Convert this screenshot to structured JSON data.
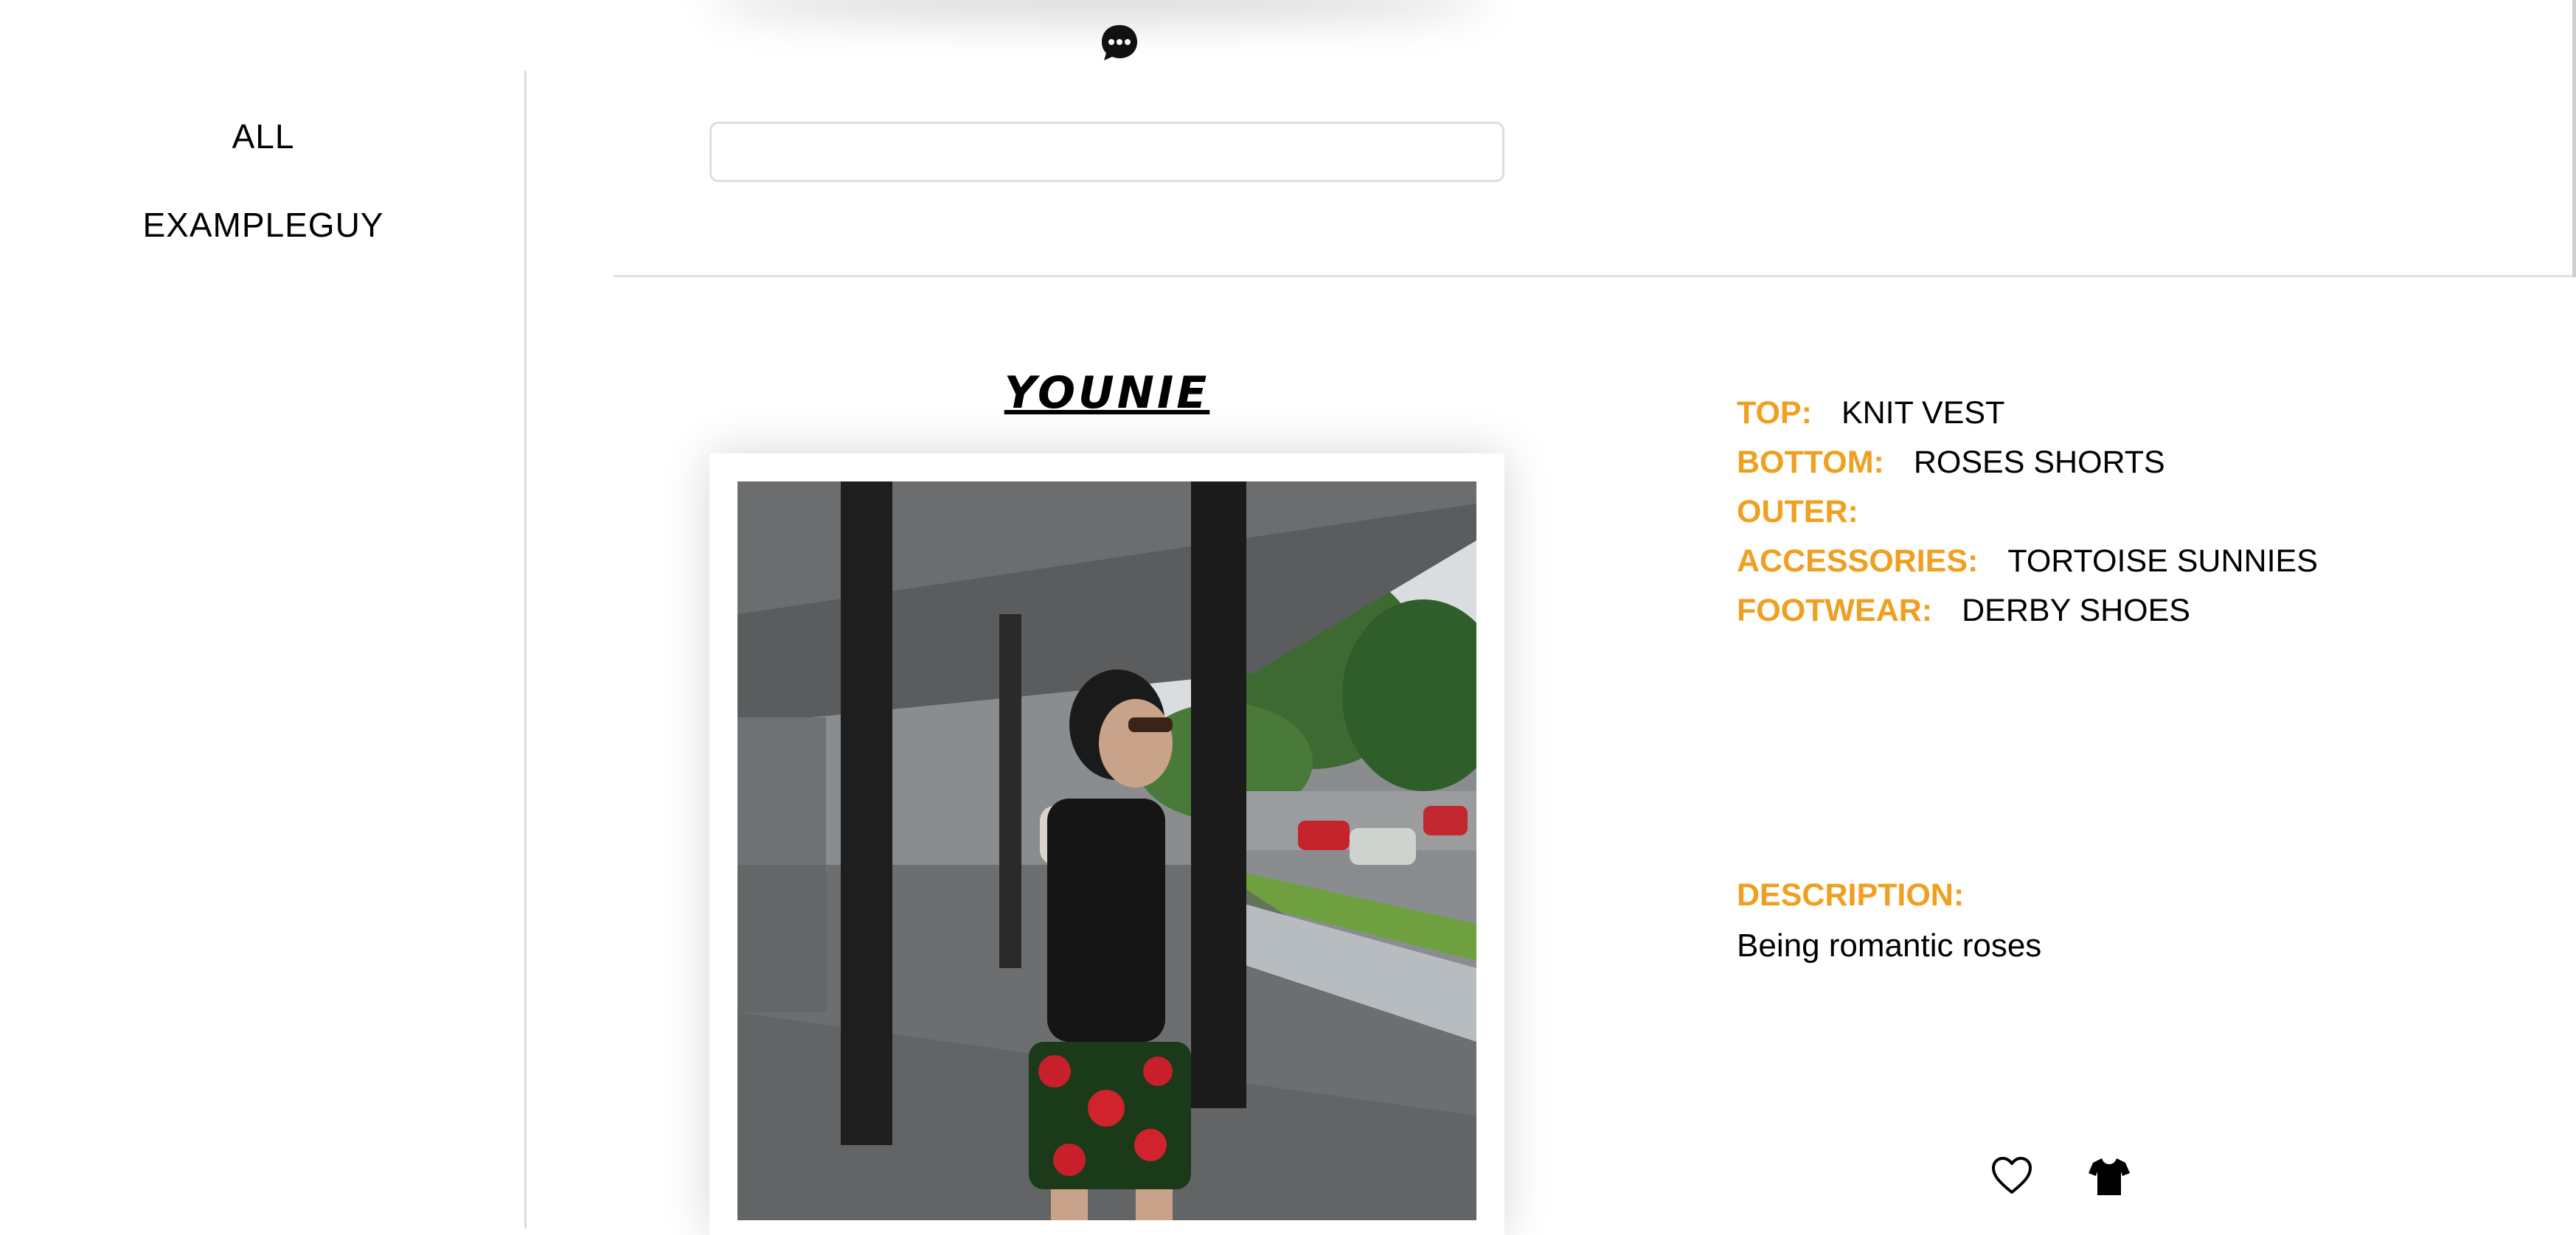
{
  "sidebar": {
    "items": [
      {
        "label": "ALL"
      },
      {
        "label": "EXAMPLEGUY"
      }
    ]
  },
  "search": {
    "value": "",
    "placeholder": ""
  },
  "post": {
    "title": "YOUNIE",
    "attributes": [
      {
        "label": "TOP:",
        "value": "KNIT VEST"
      },
      {
        "label": "BOTTOM:",
        "value": "ROSES SHORTS"
      },
      {
        "label": "OUTER:",
        "value": ""
      },
      {
        "label": "ACCESSORIES:",
        "value": "TORTOISE SUNNIES"
      },
      {
        "label": "FOOTWEAR:",
        "value": "DERBY SHOES"
      }
    ],
    "description_label": "DESCRIPTION:",
    "description": "Being romantic roses"
  },
  "icons": {
    "chat": "chat-bubble-icon",
    "like": "heart-icon",
    "wardrobe": "tshirt-icon"
  },
  "colors": {
    "accent": "#f0a020",
    "text": "#000000",
    "divider": "#e1e1e1"
  }
}
